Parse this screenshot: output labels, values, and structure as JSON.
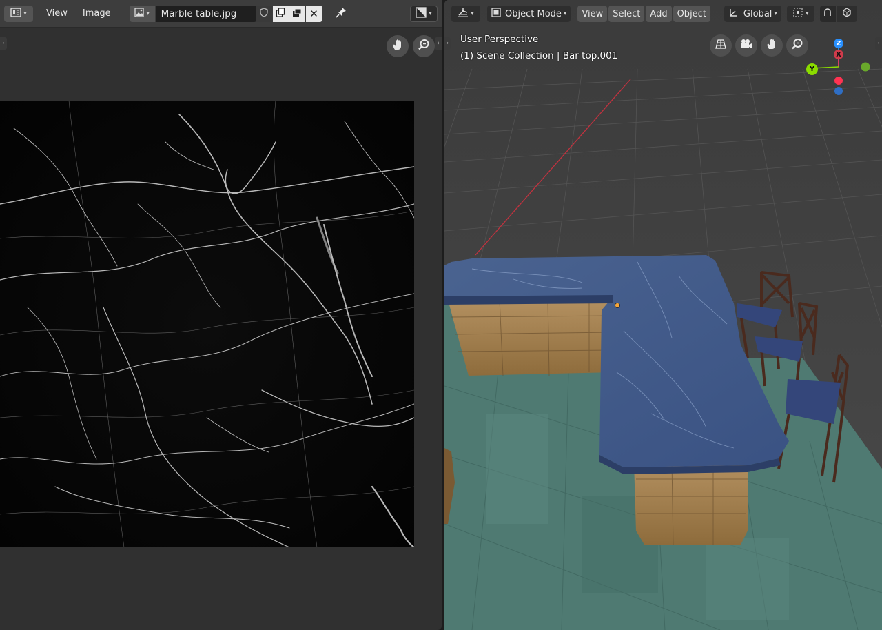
{
  "image_editor": {
    "header": {
      "editor_type_icon": "image-editor-icon",
      "menus": [
        "View",
        "Image"
      ],
      "image_browse_icon": "image-browse-icon",
      "image_name": "Marble table.jpg",
      "icons": [
        "fake-user-shield-icon",
        "duplicate-image-icon",
        "render-slot-icon",
        "close-icon",
        "pin-icon",
        "display-channels-icon"
      ]
    },
    "nav_icons": [
      "hand-pan-icon",
      "zoom-icon"
    ]
  },
  "viewport": {
    "header": {
      "editor_type_icon": "3d-viewport-icon",
      "mode": "Object Mode",
      "menus": [
        "View",
        "Select",
        "Add",
        "Object"
      ],
      "transform_orientation": "Global",
      "icons": [
        "pivot-point-icon",
        "snap-icon",
        "viewport-shading-icon"
      ]
    },
    "overlay": {
      "view_name": "User Perspective",
      "collection_info": "(1) Scene Collection | Bar top.001"
    },
    "nav_icons": [
      "orthographic-toggle-icon",
      "camera-view-icon",
      "hand-pan-icon",
      "zoom-icon"
    ],
    "gizmo": {
      "z": "Z",
      "x": "X",
      "y": "Y"
    }
  },
  "colors": {
    "panel": "#303030",
    "header": "#3d3d3d",
    "button": "#545454",
    "field": "#1f1f1f",
    "axis_red": "#ff3352",
    "axis_green": "#8bdc00",
    "axis_blue": "#2890ff",
    "countertop": "#3f5a8a",
    "floor": "#4f7a72",
    "stone": "#a5834f"
  }
}
